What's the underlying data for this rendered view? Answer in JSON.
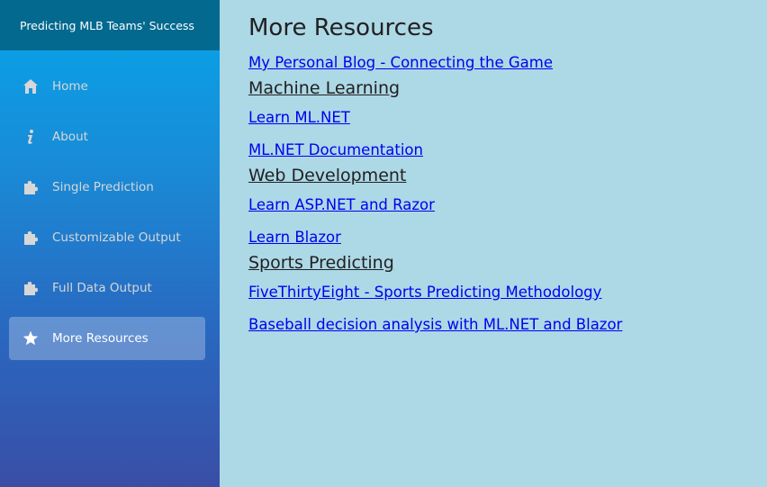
{
  "brand": {
    "title": "Predicting MLB Teams' Success"
  },
  "nav": {
    "items": [
      {
        "label": "Home",
        "icon": "home-icon"
      },
      {
        "label": "About",
        "icon": "info-icon"
      },
      {
        "label": "Single Prediction",
        "icon": "puzzle-icon"
      },
      {
        "label": "Customizable Output",
        "icon": "puzzle-icon"
      },
      {
        "label": "Full Data Output",
        "icon": "puzzle-icon"
      },
      {
        "label": "More Resources",
        "icon": "star-icon",
        "active": true
      }
    ]
  },
  "main": {
    "title": "More Resources",
    "blog_link": "My Personal Blog - Connecting the Game",
    "sections": [
      {
        "heading": "Machine Learning",
        "links": [
          "Learn ML.NET",
          "ML.NET Documentation"
        ]
      },
      {
        "heading": "Web Development",
        "links": [
          "Learn ASP.NET and Razor",
          "Learn Blazor"
        ]
      },
      {
        "heading": "Sports Predicting",
        "links": [
          "FiveThirtyEight - Sports Predicting Methodology",
          "Baseball decision analysis with ML.NET and Blazor"
        ]
      }
    ]
  },
  "colors": {
    "sidebar_top": "#05a6ea",
    "sidebar_bottom": "#3a4ea6",
    "brand_bar": "#03698f",
    "content_bg": "#add8e6",
    "link": "#0000ee"
  }
}
